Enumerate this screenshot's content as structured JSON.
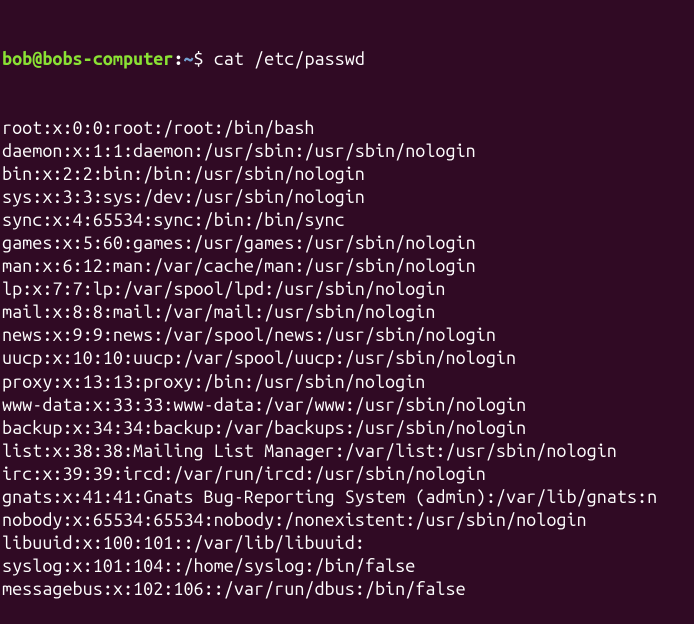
{
  "prompt": {
    "user_host": "bob@bobs-computer",
    "separator": ":",
    "path": "~",
    "symbol": "$ "
  },
  "command": "cat /etc/passwd",
  "output_lines": [
    "root:x:0:0:root:/root:/bin/bash",
    "daemon:x:1:1:daemon:/usr/sbin:/usr/sbin/nologin",
    "bin:x:2:2:bin:/bin:/usr/sbin/nologin",
    "sys:x:3:3:sys:/dev:/usr/sbin/nologin",
    "sync:x:4:65534:sync:/bin:/bin/sync",
    "games:x:5:60:games:/usr/games:/usr/sbin/nologin",
    "man:x:6:12:man:/var/cache/man:/usr/sbin/nologin",
    "lp:x:7:7:lp:/var/spool/lpd:/usr/sbin/nologin",
    "mail:x:8:8:mail:/var/mail:/usr/sbin/nologin",
    "news:x:9:9:news:/var/spool/news:/usr/sbin/nologin",
    "uucp:x:10:10:uucp:/var/spool/uucp:/usr/sbin/nologin",
    "proxy:x:13:13:proxy:/bin:/usr/sbin/nologin",
    "www-data:x:33:33:www-data:/var/www:/usr/sbin/nologin",
    "backup:x:34:34:backup:/var/backups:/usr/sbin/nologin",
    "list:x:38:38:Mailing List Manager:/var/list:/usr/sbin/nologin",
    "irc:x:39:39:ircd:/var/run/ircd:/usr/sbin/nologin",
    "gnats:x:41:41:Gnats Bug-Reporting System (admin):/var/lib/gnats:n",
    "nobody:x:65534:65534:nobody:/nonexistent:/usr/sbin/nologin",
    "libuuid:x:100:101::/var/lib/libuuid:",
    "syslog:x:101:104::/home/syslog:/bin/false",
    "messagebus:x:102:106::/var/run/dbus:/bin/false"
  ]
}
